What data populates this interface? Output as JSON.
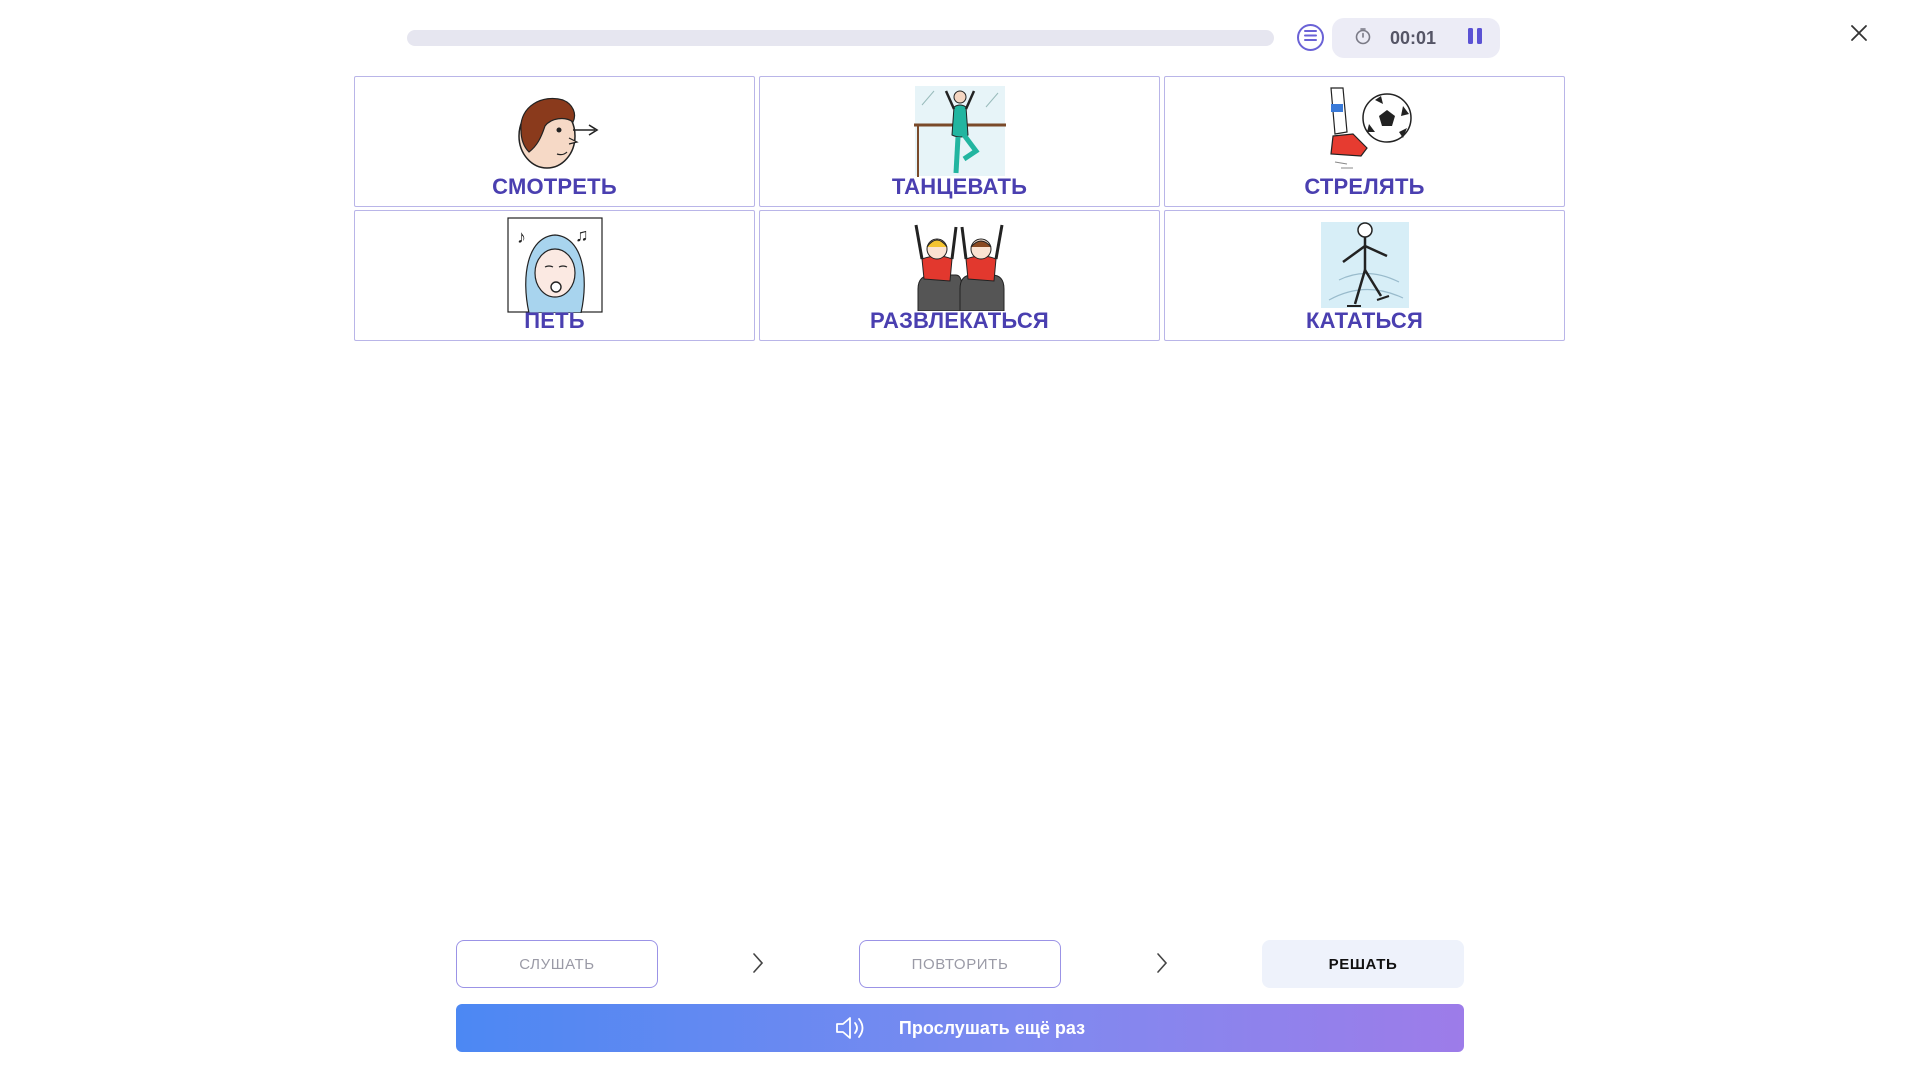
{
  "header": {
    "progress_fraction": 0.0,
    "timer": "00:01",
    "icons": {
      "list": "list-icon",
      "timer": "stopwatch-icon",
      "pause": "pause-icon",
      "close": "close-icon"
    }
  },
  "cards": [
    {
      "label": "СМОТРЕТЬ",
      "icon": "look-icon"
    },
    {
      "label": "ТАНЦЕВАТЬ",
      "icon": "dance-icon"
    },
    {
      "label": "СТРЕЛЯТЬ",
      "icon": "kick-ball-icon"
    },
    {
      "label": "ПЕТЬ",
      "icon": "sing-icon"
    },
    {
      "label": "РАЗВЛЕКАТЬСЯ",
      "icon": "have-fun-icon"
    },
    {
      "label": "КАТАТЬСЯ",
      "icon": "skate-icon"
    }
  ],
  "steps": {
    "listen": "СЛУШАТЬ",
    "repeat": "ПОВТОРИТЬ",
    "solve": "РЕШАТЬ"
  },
  "listen_again": {
    "label": "Прослушать ещё раз",
    "icon": "speaker-icon"
  },
  "colors": {
    "accent": "#4a3fb0",
    "card_border": "#b9b5e8",
    "gradient_start": "#4c88f3",
    "gradient_end": "#9d7ce9"
  }
}
